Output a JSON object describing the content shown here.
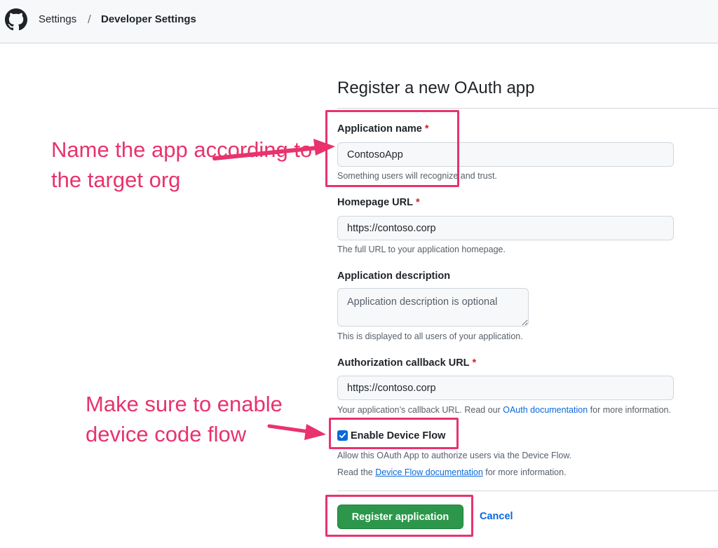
{
  "breadcrumb": {
    "settings": "Settings",
    "separator": "/",
    "developer_settings": "Developer Settings"
  },
  "page_title": "Register a new OAuth app",
  "form": {
    "app_name": {
      "label": "Application name",
      "required": "*",
      "value": "ContosoApp",
      "hint": "Something users will recognize and trust."
    },
    "homepage": {
      "label": "Homepage URL",
      "required": "*",
      "value": "https://contoso.corp",
      "hint": "The full URL to your application homepage."
    },
    "description": {
      "label": "Application description",
      "placeholder": "Application description is optional",
      "hint": "This is displayed to all users of your application."
    },
    "callback": {
      "label": "Authorization callback URL",
      "required": "*",
      "value": "https://contoso.corp",
      "hint_prefix": "Your application’s callback URL. Read our ",
      "hint_link": "OAuth documentation",
      "hint_suffix": " for more information."
    },
    "device_flow": {
      "label": "Enable Device Flow",
      "checked": true,
      "hint1": "Allow this OAuth App to authorize users via the Device Flow.",
      "hint2_prefix": "Read the ",
      "hint2_link": "Device Flow documentation",
      "hint2_suffix": " for more information."
    },
    "register_label": "Register application",
    "cancel_label": "Cancel"
  },
  "annotations": {
    "name_note": "Name the app according to the target org",
    "device_note": "Make sure to enable device code flow"
  },
  "colors": {
    "annotation": "#e8336d",
    "primary_button": "#2c974b",
    "link": "#0969da"
  },
  "icons": {
    "logo": "github-octocat-icon",
    "check": "checkmark-icon"
  }
}
